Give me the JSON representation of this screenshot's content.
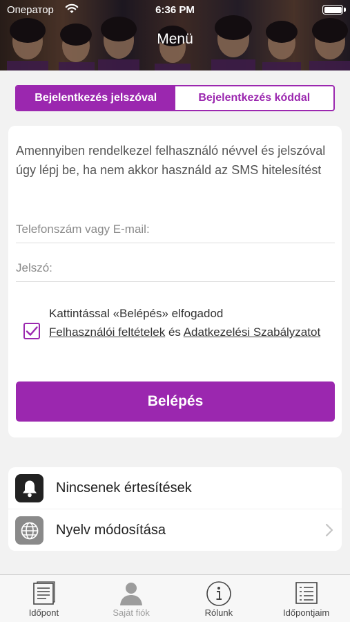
{
  "status_bar": {
    "carrier": "Оператор",
    "time": "6:36 PM"
  },
  "header": {
    "title": "Menü"
  },
  "segment": {
    "password_tab": "Bejelentkezés jelszóval",
    "code_tab": "Bejelentkezés kóddal"
  },
  "form": {
    "intro": "Amennyiben rendelkezel felhasználó névvel és jelszóval úgy lépj be, ha nem akkor használd az SMS hitelesítést",
    "phone_placeholder": "Telefonszám vagy E-mail:",
    "password_placeholder": "Jelszó:",
    "terms_prefix": "Kattintással «Belépés» elfogadod",
    "terms_link1": "Felhasználói feltételek",
    "terms_and": "és",
    "terms_link2": "Adatkezelési Szabályzatot",
    "terms_checked": true,
    "login_button": "Belépés"
  },
  "settings": {
    "notifications": "Nincsenek értesítések",
    "language": "Nyelv módosítása"
  },
  "tabs": [
    {
      "label": "Időpont",
      "icon": "document-icon"
    },
    {
      "label": "Saját fiók",
      "icon": "person-icon"
    },
    {
      "label": "Rólunk",
      "icon": "info-icon"
    },
    {
      "label": "Időpontjaim",
      "icon": "list-icon"
    }
  ],
  "colors": {
    "accent": "#9b27af"
  }
}
